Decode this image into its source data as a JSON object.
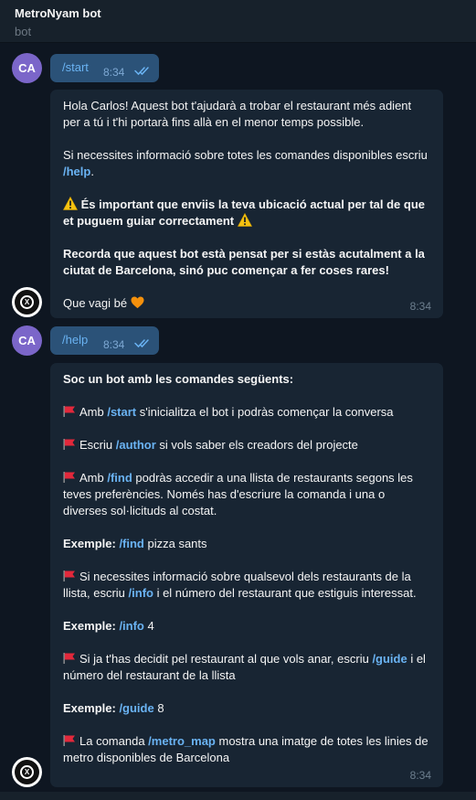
{
  "header": {
    "title": "MetroNyam bot",
    "subtitle": "bot"
  },
  "user_avatar": {
    "initials": "CA"
  },
  "bot_avatar": {
    "logo_icon": "metro-logo-icon"
  },
  "messages": {
    "start_cmd": {
      "text": "/start",
      "time": "8:34"
    },
    "welcome": {
      "p1": "Hola Carlos! Aquest bot t'ajudarà a trobar el restaurant més adient per a tú i t'hi portarà fins allà en el menor temps possible.",
      "p2_pre": "Si necessites informació sobre totes les comandes disponibles escriu ",
      "p2_cmd": "/help",
      "p2_post": ".",
      "p3": "És important que enviis la teva ubicació actual per tal de que et puguem guiar correctament",
      "p4": "Recorda que aquest bot està pensat per si estàs acutalment a la ciutat de Barcelona, sinó puc començar a fer coses rares!",
      "p5": "Que vagi bé",
      "time": "8:34"
    },
    "help_cmd": {
      "text": "/help",
      "time": "8:34"
    },
    "help": {
      "heading": "Soc un bot amb les comandes següents:",
      "l1_pre": "Amb ",
      "l1_cmd": "/start",
      "l1_post": " s'inicialitza el bot i podràs començar la conversa",
      "l2_pre": "Escriu ",
      "l2_cmd": "/author",
      "l2_post": " si vols saber els creadors del projecte",
      "l3_pre": "Amb ",
      "l3_cmd": "/find",
      "l3_post": " podràs accedir a una llista de restaurants segons les teves preferències. Només has d'escriure la comanda i una o diverses sol·licituds al costat.",
      "ex1_label": "Exemple:",
      "ex1_cmd": "/find",
      "ex1_arg": " pizza sants",
      "l4_pre": "Si necessites informació sobre qualsevol dels restaurants de la llista, escriu ",
      "l4_cmd": "/info",
      "l4_post": " i el número del restaurant que estiguis interessat.",
      "ex2_label": "Exemple:",
      "ex2_cmd": "/info",
      "ex2_arg": " 4",
      "l5_pre": "Si ja t'has decidit pel restaurant al que vols anar, escriu ",
      "l5_cmd": "/guide",
      "l5_post": " i el número del restaurant de la llista",
      "ex3_label": "Exemple:",
      "ex3_cmd": "/guide",
      "ex3_arg": " 8",
      "l6_pre": "La comanda ",
      "l6_cmd": "/metro_map",
      "l6_post": " mostra una imatge de totes les linies de metro disponibles de Barcelona",
      "time": "8:34"
    }
  },
  "colors": {
    "background": "#0e1621",
    "header": "#17212b",
    "incoming_bubble": "#182533",
    "outgoing_bubble": "#2b5278",
    "link": "#6ab3f3",
    "user_avatar": "#7b66c9"
  },
  "icons": [
    "double-check-icon",
    "warning-icon",
    "orange-heart-icon",
    "red-flag-icon",
    "metro-logo-icon"
  ]
}
